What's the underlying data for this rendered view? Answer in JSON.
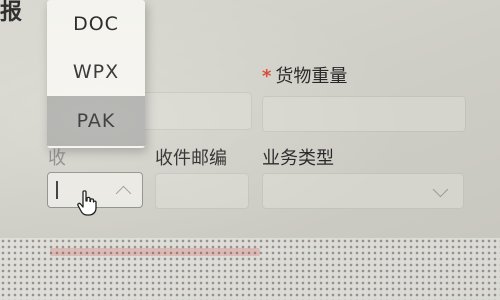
{
  "header": {
    "title_fragment": "报"
  },
  "unit_dropdown": {
    "options": [
      "DOC",
      "WPX",
      "PAK"
    ],
    "highlighted_option": "PAK"
  },
  "form": {
    "weight_label": "货物重量",
    "weight_required_mark": "*",
    "postcode_label": "收件邮编",
    "business_type_label": "业务类型",
    "partial_label": "收"
  },
  "colors": {
    "required_mark": "#d8402e",
    "highlight": "#a9aaa6"
  }
}
